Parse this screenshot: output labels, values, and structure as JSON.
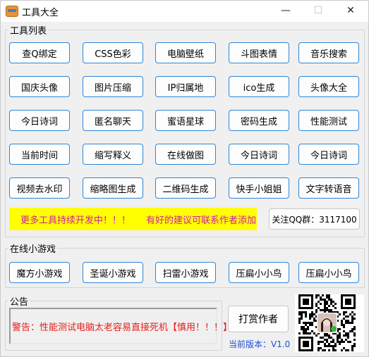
{
  "window": {
    "title": "工具大全",
    "minimize_symbol": "—",
    "maximize_symbol": "☐",
    "close_symbol": "✕"
  },
  "tools": {
    "legend": "工具列表",
    "rows": [
      [
        "查Q绑定",
        "CSS色彩",
        "电脑壁纸",
        "斗图表情",
        "音乐搜索"
      ],
      [
        "国庆头像",
        "图片压缩",
        "IP归属地",
        "ico生成",
        "头像大全"
      ],
      [
        "今日诗词",
        "匿名聊天",
        "蜜语星球",
        "密码生成",
        "性能测试"
      ],
      [
        "当前时间",
        "缩写释义",
        "在线做图",
        "今日诗词",
        "今日诗词"
      ],
      [
        "视频去水印",
        "缩略图生成",
        "二维码生成",
        "快手小姐姐",
        "文字转语音"
      ]
    ],
    "banner_left": "更多工具持续开发中！！！",
    "banner_right": "有好的建议可联系作者添加",
    "qq_label": "关注QQ群：3117100"
  },
  "games": {
    "legend": "在线小游戏",
    "items": [
      "魔方小游戏",
      "圣诞小游戏",
      "扫雷小游戏",
      "压扁小小鸟",
      "压扁小小鸟"
    ]
  },
  "notice": {
    "legend": "公告",
    "text": "警告：性能测试电脑太老容易直接死机【慎用！！！】",
    "reward_label": "打赏作者",
    "version": "当前版本：V1.0"
  },
  "colors": {
    "accent_border": "#2e86d6",
    "banner_bg": "#ffff00",
    "banner_text": "#d11aa6",
    "warning_text": "#e3201b",
    "version_text": "#1c4fd0"
  },
  "icons": {
    "app": "toolbox-icon",
    "qr": "wechat-qr-code"
  }
}
